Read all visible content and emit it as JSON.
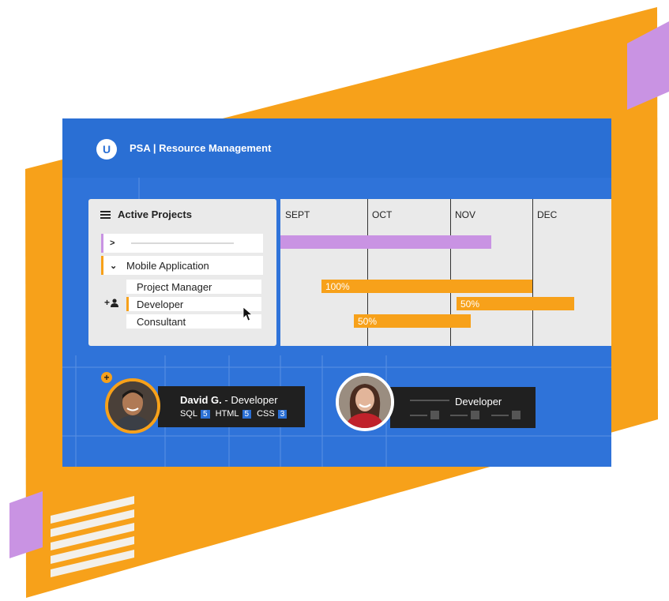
{
  "app": {
    "logo_letter": "U",
    "title": "PSA | Resource Management"
  },
  "projects": {
    "heading": "Active Projects",
    "collapsed_project": {
      "expand_icon": "chevron-right-icon",
      "accent": "#c993e3"
    },
    "expanded_project": {
      "label": "Mobile Application",
      "collapse_icon": "chevron-down-icon",
      "accent": "#f7a11a"
    },
    "roles": [
      "Project Manager",
      "Developer",
      "Consultant"
    ],
    "add_icon": "add-user-icon"
  },
  "gantt": {
    "months": [
      "SEPT",
      "OCT",
      "NOV",
      "DEC"
    ],
    "bars": [
      {
        "label": "",
        "color": "#c993e3"
      },
      {
        "label": "100%",
        "color": "#f7a11a"
      },
      {
        "label": "50%",
        "color": "#f7a11a"
      },
      {
        "label": "50%",
        "color": "#f7a11a"
      }
    ]
  },
  "people": [
    {
      "name": "David G.",
      "role": "- Developer",
      "skills": [
        {
          "name": "SQL",
          "level": "5"
        },
        {
          "name": "HTML",
          "level": "5"
        },
        {
          "name": "CSS",
          "level": "3"
        }
      ],
      "badge": "+"
    },
    {
      "role": "Developer"
    }
  ],
  "colors": {
    "orange": "#f7a11a",
    "blue": "#2f73d9",
    "lavender": "#c993e3"
  }
}
